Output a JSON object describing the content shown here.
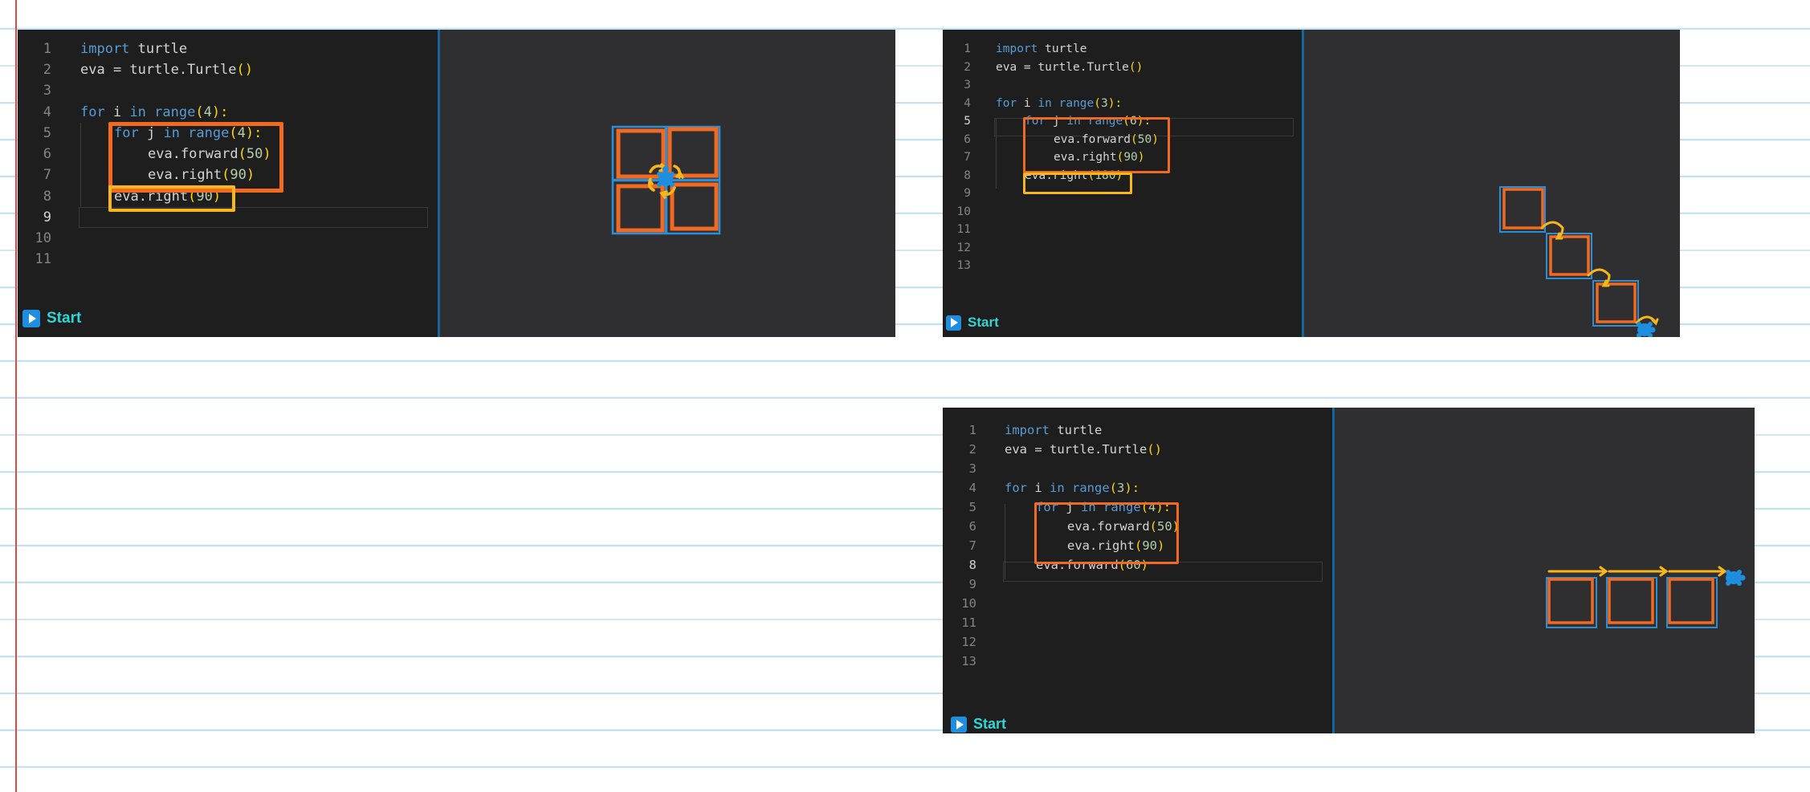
{
  "panels": [
    {
      "start_label": "Start",
      "lines": [
        {
          "n": "1"
        },
        {
          "n": "2"
        },
        {
          "n": "3"
        },
        {
          "n": "4"
        },
        {
          "n": "5"
        },
        {
          "n": "6"
        },
        {
          "n": "7"
        },
        {
          "n": "8"
        },
        {
          "n": "9"
        },
        {
          "n": "10"
        },
        {
          "n": "11"
        }
      ],
      "code": {
        "l1a": "import",
        "l1b": " turtle",
        "l2a": "eva = turtle.Turtle",
        "l2b": "()",
        "l4a": "for",
        "l4b": " i ",
        "l4c": "in",
        "l4d": " ",
        "l4e": "range",
        "l4f": "(",
        "l4g": "4",
        "l4h": "):",
        "l5a": "for",
        "l5b": " j ",
        "l5c": "in",
        "l5d": " ",
        "l5e": "range",
        "l5f": "(",
        "l5g": "4",
        "l5h": "):",
        "l6a": "eva.forward",
        "l6b": "(",
        "l6c": "50",
        "l6d": ")",
        "l7a": "eva.right",
        "l7b": "(",
        "l7c": "90",
        "l7d": ")",
        "l8a": "eva.right",
        "l8b": "(",
        "l8c": "90",
        "l8d": ")"
      }
    },
    {
      "start_label": "Start",
      "lines": [
        {
          "n": "1"
        },
        {
          "n": "2"
        },
        {
          "n": "3"
        },
        {
          "n": "4"
        },
        {
          "n": "5"
        },
        {
          "n": "6"
        },
        {
          "n": "7"
        },
        {
          "n": "8"
        },
        {
          "n": "9"
        },
        {
          "n": "10"
        },
        {
          "n": "11"
        },
        {
          "n": "12"
        },
        {
          "n": "13"
        }
      ],
      "code": {
        "l1a": "import",
        "l1b": " turtle",
        "l2a": "eva = turtle.Turtle",
        "l2b": "()",
        "l4a": "for",
        "l4b": " i ",
        "l4c": "in",
        "l4d": " ",
        "l4e": "range",
        "l4f": "(",
        "l4g": "3",
        "l4h": "):",
        "l5a": "for",
        "l5b": " j ",
        "l5c": "in",
        "l5d": " ",
        "l5e": "range",
        "l5f": "(",
        "l5g": "6",
        "l5h": "):",
        "l6a": "eva.forward",
        "l6b": "(",
        "l6c": "50",
        "l6d": ")",
        "l7a": "eva.right",
        "l7b": "(",
        "l7c": "90",
        "l7d": ")",
        "l8a": "eva.right",
        "l8b": "(",
        "l8c": "180",
        "l8d": ")"
      }
    },
    {
      "start_label": "Start",
      "lines": [
        {
          "n": "1"
        },
        {
          "n": "2"
        },
        {
          "n": "3"
        },
        {
          "n": "4"
        },
        {
          "n": "5"
        },
        {
          "n": "6"
        },
        {
          "n": "7"
        },
        {
          "n": "8"
        },
        {
          "n": "9"
        },
        {
          "n": "10"
        },
        {
          "n": "11"
        },
        {
          "n": "12"
        },
        {
          "n": "13"
        }
      ],
      "code": {
        "l1a": "import",
        "l1b": " turtle",
        "l2a": "eva = turtle.Turtle",
        "l2b": "()",
        "l4a": "for",
        "l4b": " i ",
        "l4c": "in",
        "l4d": " ",
        "l4e": "range",
        "l4f": "(",
        "l4g": "3",
        "l4h": "):",
        "l5a": "for",
        "l5b": " j ",
        "l5c": "in",
        "l5d": " ",
        "l5e": "range",
        "l5f": "(",
        "l5g": "4",
        "l5h": "):",
        "l6a": "eva.forward",
        "l6b": "(",
        "l6c": "50",
        "l6d": ")",
        "l7a": "eva.right",
        "l7b": "(",
        "l7c": "90",
        "l7d": ")",
        "l8a": "eva.forward",
        "l8b": "(",
        "l8c": "60",
        "l8d": ")"
      }
    }
  ],
  "colors": {
    "editor_bg": "#1e1e1e",
    "canvas_bg": "#2f2f31",
    "keyword": "#569cd6",
    "number": "#b5cea8",
    "bracket": "#ffd700",
    "highlight_orange": "#f26a22",
    "highlight_yellow": "#f7b619",
    "turtle_blue": "#1e8fe0",
    "start_text": "#2fd6d6",
    "page_rule": "#bfe0f2",
    "margin_rule": "#e04848"
  },
  "icons": [
    "play-icon",
    "turtle-icon"
  ]
}
